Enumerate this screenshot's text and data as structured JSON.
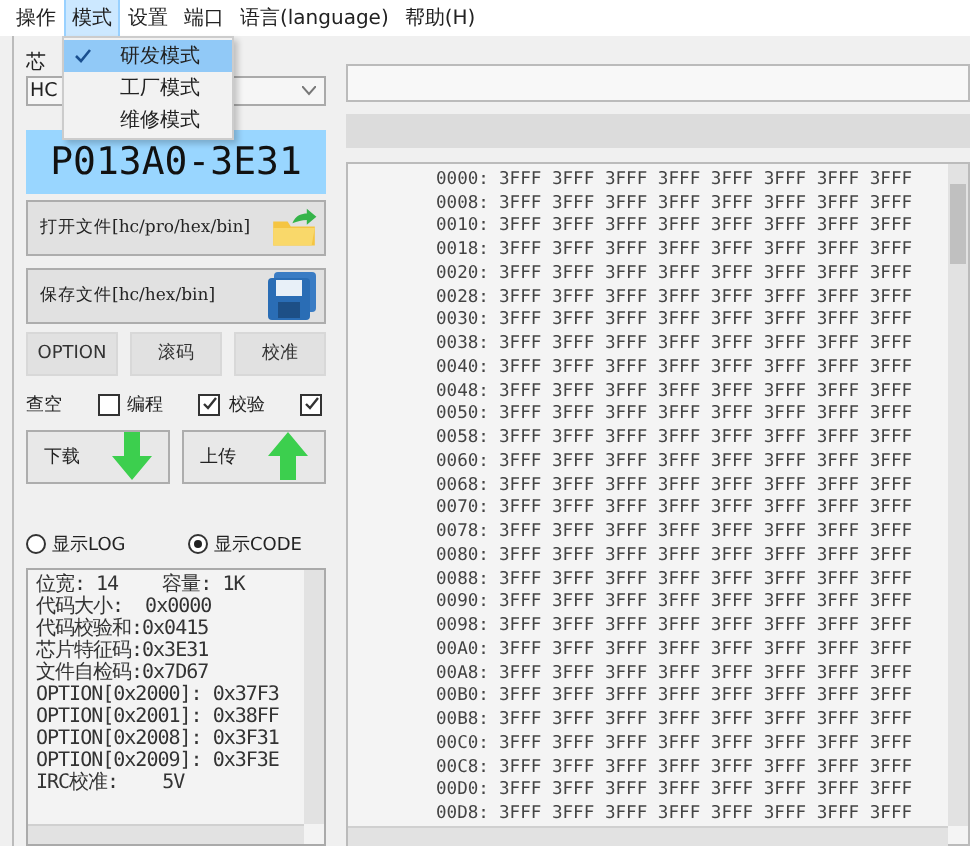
{
  "menu_bar": [
    {
      "label": "操作",
      "selected": false
    },
    {
      "label": "模式",
      "selected": true
    },
    {
      "label": "设置",
      "selected": false
    },
    {
      "label": "端口",
      "selected": false
    },
    {
      "label": "语言(language)",
      "selected": false
    },
    {
      "label": "帮助(H)",
      "selected": false
    }
  ],
  "dropdown": [
    {
      "label": "研发模式",
      "checked": true,
      "selected": true
    },
    {
      "label": "工厂模式",
      "checked": false,
      "selected": false
    },
    {
      "label": "维修模式",
      "checked": false,
      "selected": false
    }
  ],
  "chip": {
    "label": "芯",
    "value": "HC"
  },
  "device_display": "P013A0-3E31",
  "file_buttons": [
    {
      "label": "打开文件[hc/pro/hex/bin]",
      "kind": "open"
    },
    {
      "label": "保存文件[hc/hex/bin]",
      "kind": "save"
    }
  ],
  "action_buttons": [
    "OPTION",
    "滚码",
    "校准"
  ],
  "checks": [
    {
      "label": "查空",
      "checked": false
    },
    {
      "label": "编程",
      "checked": true
    },
    {
      "label": "校验",
      "checked": true
    }
  ],
  "transfer_buttons": [
    {
      "label": "下载",
      "kind": "download"
    },
    {
      "label": "上传",
      "kind": "upload"
    }
  ],
  "view_radios": [
    {
      "label": "显示LOG",
      "selected": false
    },
    {
      "label": "显示CODE",
      "selected": true
    }
  ],
  "log_lines": [
    "位宽: 14    容量: 1K",
    "代码大小:  0x0000",
    "代码校验和:0x0415",
    "芯片特征码:0x3E31",
    "文件自检码:0x7D67",
    "OPTION[0x2000]: 0x37F3",
    "OPTION[0x2001]: 0x38FF",
    "OPTION[0x2008]: 0x3F31",
    "OPTION[0x2009]: 0x3F3E",
    "IRC校准:    5V"
  ],
  "hex_rows": [
    {
      "address": "0000:",
      "data": "3FFF 3FFF 3FFF 3FFF 3FFF 3FFF 3FFF 3FFF"
    },
    {
      "address": "0008:",
      "data": "3FFF 3FFF 3FFF 3FFF 3FFF 3FFF 3FFF 3FFF"
    },
    {
      "address": "0010:",
      "data": "3FFF 3FFF 3FFF 3FFF 3FFF 3FFF 3FFF 3FFF"
    },
    {
      "address": "0018:",
      "data": "3FFF 3FFF 3FFF 3FFF 3FFF 3FFF 3FFF 3FFF"
    },
    {
      "address": "0020:",
      "data": "3FFF 3FFF 3FFF 3FFF 3FFF 3FFF 3FFF 3FFF"
    },
    {
      "address": "0028:",
      "data": "3FFF 3FFF 3FFF 3FFF 3FFF 3FFF 3FFF 3FFF"
    },
    {
      "address": "0030:",
      "data": "3FFF 3FFF 3FFF 3FFF 3FFF 3FFF 3FFF 3FFF"
    },
    {
      "address": "0038:",
      "data": "3FFF 3FFF 3FFF 3FFF 3FFF 3FFF 3FFF 3FFF"
    },
    {
      "address": "0040:",
      "data": "3FFF 3FFF 3FFF 3FFF 3FFF 3FFF 3FFF 3FFF"
    },
    {
      "address": "0048:",
      "data": "3FFF 3FFF 3FFF 3FFF 3FFF 3FFF 3FFF 3FFF"
    },
    {
      "address": "0050:",
      "data": "3FFF 3FFF 3FFF 3FFF 3FFF 3FFF 3FFF 3FFF"
    },
    {
      "address": "0058:",
      "data": "3FFF 3FFF 3FFF 3FFF 3FFF 3FFF 3FFF 3FFF"
    },
    {
      "address": "0060:",
      "data": "3FFF 3FFF 3FFF 3FFF 3FFF 3FFF 3FFF 3FFF"
    },
    {
      "address": "0068:",
      "data": "3FFF 3FFF 3FFF 3FFF 3FFF 3FFF 3FFF 3FFF"
    },
    {
      "address": "0070:",
      "data": "3FFF 3FFF 3FFF 3FFF 3FFF 3FFF 3FFF 3FFF"
    },
    {
      "address": "0078:",
      "data": "3FFF 3FFF 3FFF 3FFF 3FFF 3FFF 3FFF 3FFF"
    },
    {
      "address": "0080:",
      "data": "3FFF 3FFF 3FFF 3FFF 3FFF 3FFF 3FFF 3FFF"
    },
    {
      "address": "0088:",
      "data": "3FFF 3FFF 3FFF 3FFF 3FFF 3FFF 3FFF 3FFF"
    },
    {
      "address": "0090:",
      "data": "3FFF 3FFF 3FFF 3FFF 3FFF 3FFF 3FFF 3FFF"
    },
    {
      "address": "0098:",
      "data": "3FFF 3FFF 3FFF 3FFF 3FFF 3FFF 3FFF 3FFF"
    },
    {
      "address": "00A0:",
      "data": "3FFF 3FFF 3FFF 3FFF 3FFF 3FFF 3FFF 3FFF"
    },
    {
      "address": "00A8:",
      "data": "3FFF 3FFF 3FFF 3FFF 3FFF 3FFF 3FFF 3FFF"
    },
    {
      "address": "00B0:",
      "data": "3FFF 3FFF 3FFF 3FFF 3FFF 3FFF 3FFF 3FFF"
    },
    {
      "address": "00B8:",
      "data": "3FFF 3FFF 3FFF 3FFF 3FFF 3FFF 3FFF 3FFF"
    },
    {
      "address": "00C0:",
      "data": "3FFF 3FFF 3FFF 3FFF 3FFF 3FFF 3FFF 3FFF"
    },
    {
      "address": "00C8:",
      "data": "3FFF 3FFF 3FFF 3FFF 3FFF 3FFF 3FFF 3FFF"
    },
    {
      "address": "00D0:",
      "data": "3FFF 3FFF 3FFF 3FFF 3FFF 3FFF 3FFF 3FFF"
    },
    {
      "address": "00D8:",
      "data": "3FFF 3FFF 3FFF 3FFF 3FFF 3FFF 3FFF 3FFF"
    }
  ]
}
